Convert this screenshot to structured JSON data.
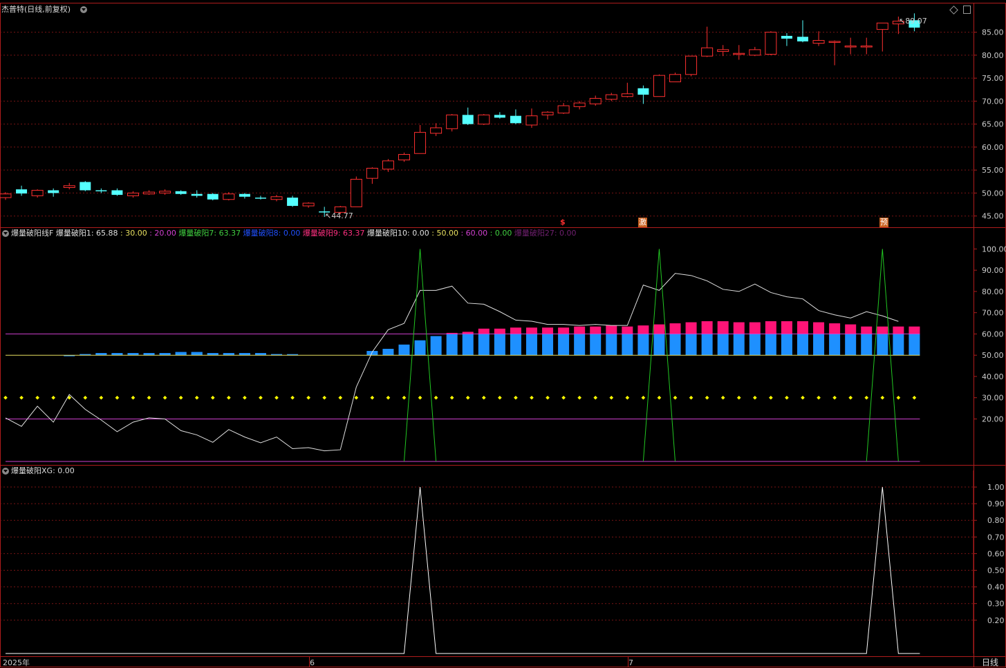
{
  "header": {
    "stock_name": "杰普特",
    "period_label": "(日线,前复权)",
    "high_marker": "89.07",
    "low_marker": "44.77"
  },
  "signals": {
    "s": "$",
    "ji": "激",
    "yu": "预"
  },
  "indicator1": {
    "name": "爆量破阳线F",
    "items": [
      {
        "text": "爆量破阳1: 65.88",
        "color": "#e0e0e0"
      },
      {
        "text": ": 30.00",
        "color": "#e8e060"
      },
      {
        "text": ": 20.00",
        "color": "#d040d0"
      },
      {
        "text": "爆量破阳7: 63.37",
        "color": "#40d040"
      },
      {
        "text": "爆量破阳8: 0.00",
        "color": "#2050ff"
      },
      {
        "text": "爆量破阳9: 63.37",
        "color": "#ff3080"
      },
      {
        "text": "爆量破阳10: 0.00",
        "color": "#e0e0e0"
      },
      {
        "text": ": 50.00",
        "color": "#e8e060"
      },
      {
        "text": ": 60.00",
        "color": "#d040d0"
      },
      {
        "text": ": 0.00",
        "color": "#40d040"
      },
      {
        "text": "爆量破阳27: 0.00",
        "color": "#702070"
      }
    ]
  },
  "indicator2": {
    "name": "爆量破阳XG",
    "value": ": 0.00"
  },
  "footer": {
    "year_label": "2025年",
    "month6": "6",
    "month7": "7",
    "period_button": "日线"
  },
  "colors": {
    "up": "#ff3030",
    "down": "#54ffff",
    "grid": "#7a1414",
    "sep": "#b01c1c"
  },
  "chart_data": [
    {
      "type": "candlestick",
      "title": "杰普特 (日线,前复权)",
      "ylim": [
        43,
        89
      ],
      "yticks": [
        "45.00",
        "50.00",
        "55.00",
        "60.00",
        "65.00",
        "70.00",
        "75.00",
        "80.00",
        "85.00"
      ],
      "ohlc": [
        [
          49.0,
          50.2,
          48.5,
          49.8
        ],
        [
          50.8,
          51.6,
          49.4,
          49.9
        ],
        [
          49.4,
          50.8,
          49.0,
          50.6
        ],
        [
          50.6,
          51.0,
          49.2,
          50.0
        ],
        [
          51.2,
          52.2,
          50.8,
          51.6
        ],
        [
          52.4,
          52.6,
          50.4,
          50.6
        ],
        [
          50.6,
          51.0,
          50.0,
          50.4
        ],
        [
          50.6,
          51.0,
          49.4,
          49.6
        ],
        [
          49.4,
          50.4,
          49.0,
          50.0
        ],
        [
          49.8,
          50.6,
          49.6,
          50.2
        ],
        [
          50.0,
          50.8,
          49.6,
          50.4
        ],
        [
          50.4,
          50.6,
          49.6,
          49.8
        ],
        [
          49.8,
          50.6,
          49.0,
          49.4
        ],
        [
          49.8,
          50.0,
          48.4,
          48.6
        ],
        [
          48.6,
          50.2,
          48.4,
          49.8
        ],
        [
          49.8,
          50.0,
          48.8,
          49.2
        ],
        [
          49.0,
          49.4,
          48.6,
          48.9
        ],
        [
          48.6,
          49.6,
          48.2,
          49.2
        ],
        [
          49.0,
          49.4,
          47.0,
          47.2
        ],
        [
          47.2,
          48.0,
          46.8,
          47.8
        ],
        [
          46.0,
          47.0,
          44.8,
          45.8
        ],
        [
          45.8,
          47.2,
          45.4,
          47.0
        ],
        [
          47.0,
          53.6,
          47.0,
          53.0
        ],
        [
          53.2,
          55.6,
          52.0,
          55.4
        ],
        [
          55.2,
          57.4,
          54.6,
          57.0
        ],
        [
          57.2,
          58.8,
          56.8,
          58.4
        ],
        [
          58.6,
          64.8,
          58.6,
          63.2
        ],
        [
          63.0,
          65.2,
          62.4,
          64.2
        ],
        [
          64.0,
          67.2,
          63.4,
          67.0
        ],
        [
          67.0,
          68.6,
          64.8,
          65.0
        ],
        [
          65.0,
          67.2,
          64.8,
          67.0
        ],
        [
          67.0,
          67.6,
          66.2,
          66.4
        ],
        [
          66.8,
          68.2,
          65.0,
          65.2
        ],
        [
          64.8,
          68.4,
          64.2,
          66.8
        ],
        [
          67.0,
          67.8,
          66.0,
          67.6
        ],
        [
          67.4,
          69.6,
          67.2,
          69.0
        ],
        [
          68.8,
          70.0,
          68.2,
          69.6
        ],
        [
          69.4,
          71.2,
          69.0,
          70.6
        ],
        [
          70.4,
          71.8,
          70.0,
          71.4
        ],
        [
          71.0,
          74.0,
          70.8,
          71.6
        ],
        [
          72.8,
          73.4,
          69.4,
          71.4
        ],
        [
          71.0,
          75.8,
          71.0,
          75.6
        ],
        [
          74.2,
          76.2,
          74.2,
          75.8
        ],
        [
          75.8,
          79.8,
          75.4,
          79.8
        ],
        [
          79.8,
          86.2,
          79.6,
          81.6
        ],
        [
          80.8,
          82.2,
          79.8,
          81.2
        ],
        [
          80.2,
          82.2,
          79.0,
          80.4
        ],
        [
          80.0,
          81.8,
          79.8,
          81.2
        ],
        [
          80.2,
          85.2,
          80.0,
          85.0
        ],
        [
          84.2,
          84.8,
          82.0,
          83.6
        ],
        [
          84.0,
          87.6,
          82.8,
          83.0
        ],
        [
          82.6,
          85.2,
          82.0,
          83.2
        ],
        [
          83.0,
          83.2,
          77.8,
          83.0
        ],
        [
          82.0,
          83.8,
          80.2,
          82.0
        ],
        [
          82.0,
          83.8,
          80.2,
          82.0
        ],
        [
          85.6,
          87.0,
          80.8,
          87.0
        ],
        [
          86.8,
          88.4,
          84.6,
          87.4
        ],
        [
          87.6,
          89.1,
          85.2,
          86.0
        ]
      ],
      "series_signals": [
        {
          "index": 35,
          "label": "$"
        },
        {
          "index": 40,
          "label": "激"
        },
        {
          "index": 55,
          "label": "预"
        }
      ]
    },
    {
      "type": "line",
      "title": "爆量破阳线F",
      "ylim": [
        0,
        105
      ],
      "yticks": [
        "20.00",
        "30.00",
        "40.00",
        "50.00",
        "60.00",
        "70.00",
        "80.00",
        "90.00",
        "100.00"
      ],
      "hlines": [
        {
          "y": 60,
          "color": "#d040d0"
        },
        {
          "y": 50,
          "color": "#e8e060"
        },
        {
          "y": 20,
          "color": "#d040d0"
        }
      ],
      "dotted_line": {
        "y": 30,
        "color": "#ffff00"
      },
      "series": [
        {
          "name": "爆量破阳1",
          "color": "#e0e0e0",
          "values": [
            20.5,
            16.5,
            26,
            18.5,
            31.5,
            24.5,
            19.5,
            14,
            18.5,
            20.5,
            20,
            14.5,
            12.5,
            9,
            15,
            11.5,
            8.8,
            11.5,
            6,
            6.5,
            5,
            5.5,
            35,
            51.5,
            62,
            65,
            80.5,
            80.5,
            82.5,
            74.5,
            74,
            70.5,
            66.5,
            66,
            64.5,
            64.5,
            64,
            64.5,
            64,
            64,
            83,
            80.5,
            88.5,
            87.5,
            85,
            81,
            80,
            83.5,
            79.5,
            77.5,
            76.5,
            71,
            69,
            67.5,
            70.5,
            68.5,
            65.9
          ]
        },
        {
          "name": "爆量破阳9",
          "color": "#ff1477",
          "type": "bar",
          "values": [
            50,
            50,
            50,
            50,
            50,
            50.5,
            51,
            51,
            51,
            51,
            51,
            51.5,
            51.5,
            51,
            51,
            51,
            51,
            50.5,
            50.5,
            50,
            50,
            50,
            50,
            52,
            53,
            55,
            57,
            59,
            60.5,
            61,
            62.5,
            62.5,
            63,
            63,
            63,
            63,
            63.5,
            63.5,
            64,
            63.5,
            64,
            64.5,
            65,
            65.5,
            66,
            66,
            65.5,
            65.5,
            66,
            66,
            66,
            65.5,
            65,
            64.5,
            63.5,
            63.5,
            63.5,
            63.5
          ]
        },
        {
          "name": "爆量破阳7",
          "color": "#22c822",
          "peaks": [
            {
              "index": 26,
              "value": 100
            },
            {
              "index": 41,
              "value": 100
            },
            {
              "index": 55,
              "value": 100
            }
          ]
        }
      ]
    },
    {
      "type": "line",
      "title": "爆量破阳XG",
      "ylim": [
        0,
        1.05
      ],
      "yticks": [
        "0.20",
        "0.30",
        "0.40",
        "0.50",
        "0.60",
        "0.70",
        "0.80",
        "0.90",
        "1.00"
      ],
      "series": [
        {
          "name": "爆量破阳XG",
          "color": "#ffffff",
          "peaks": [
            {
              "index": 26,
              "value": 1
            },
            {
              "index": 55,
              "value": 1
            }
          ]
        }
      ]
    }
  ]
}
